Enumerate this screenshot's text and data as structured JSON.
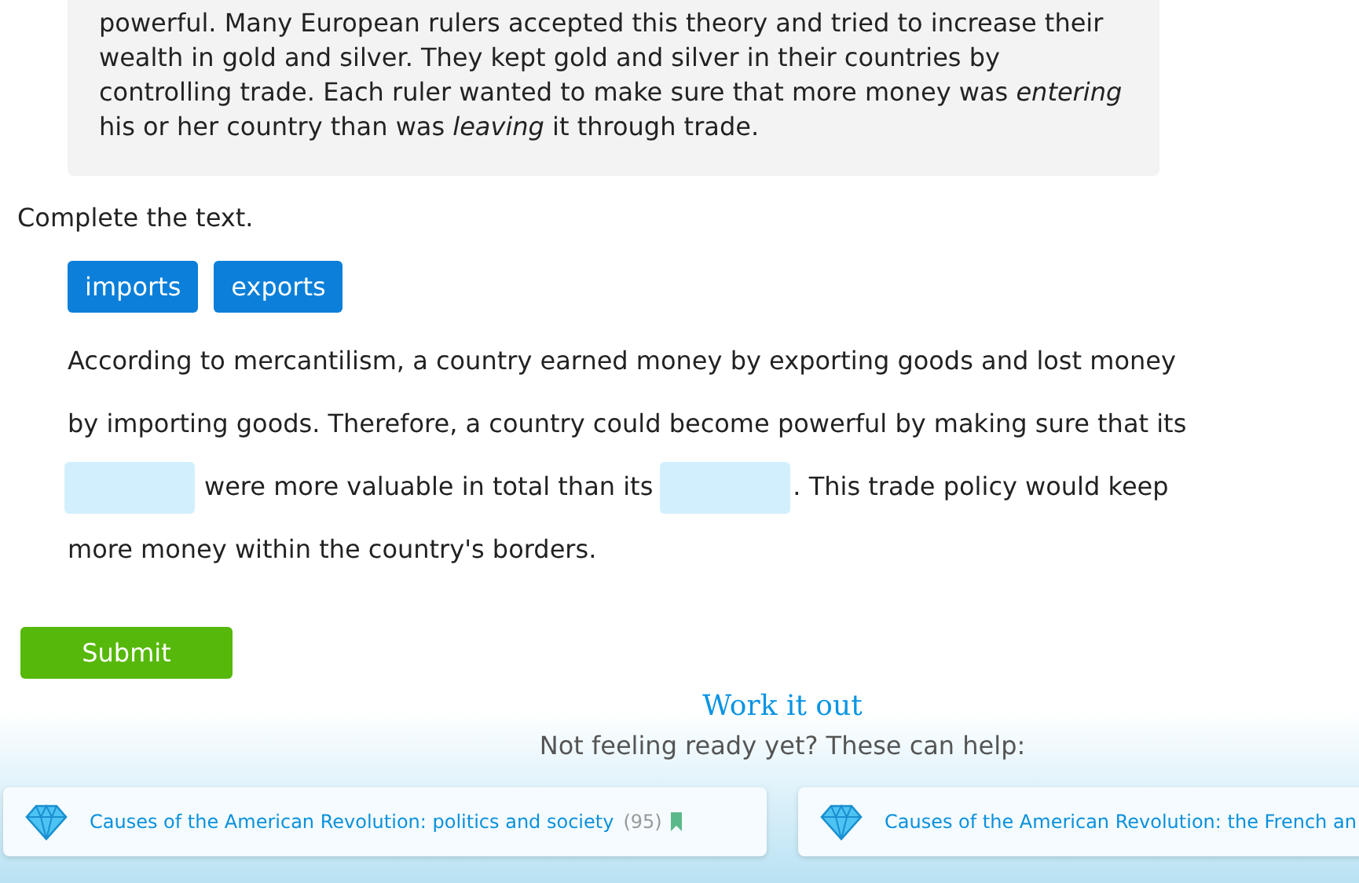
{
  "passage": "powerful. Many European rulers accepted this theory and tried to increase their wealth in gold and silver. They kept gold and silver in their countries by controlling trade. Each ruler wanted to make sure that more money was *entering* his or her country than was *leaving* it through trade.",
  "instruction": "Complete the text.",
  "word_bank": [
    "imports",
    "exports"
  ],
  "paragraph": [
    [
      {
        "kind": "text",
        "text": "According to mercantilism, a country earned money by exporting goods and lost money"
      }
    ],
    [
      {
        "kind": "text",
        "text": "by importing goods. Therefore, a country could become powerful by making sure that its"
      }
    ],
    [
      {
        "kind": "blank"
      },
      {
        "kind": "text",
        "text": "were more valuable in total than its"
      },
      {
        "kind": "blank"
      },
      {
        "kind": "text",
        "text": ". This trade policy would keep"
      }
    ],
    [
      {
        "kind": "text",
        "text": "more money within the country's borders."
      }
    ]
  ],
  "submit": "Submit",
  "help": {
    "title": "Work it out",
    "subtitle": "Not feeling ready yet? These can help:",
    "cards": [
      {
        "title": "Causes of the American Revolution: politics and society",
        "count": "(95)",
        "bookmarked": true
      },
      {
        "title": "Causes of the American Revolution: the French an"
      }
    ]
  }
}
